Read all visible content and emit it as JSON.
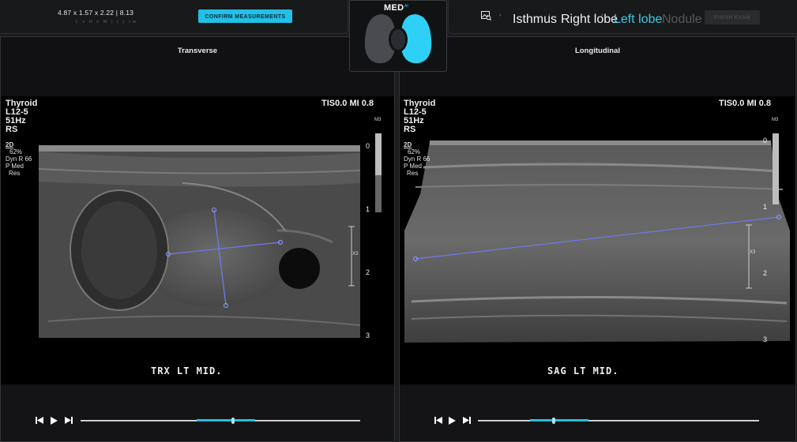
{
  "header": {
    "measurement": "4.87 x 1.57  x  2.22  | 8.13",
    "measurement_sub": "L  x  H  x  W  |  (  )  cm",
    "confirm_label": "CONFIRM MEASUREMENTS",
    "finish_label": "FINISH EXAM",
    "logo": {
      "text": "MED",
      "superscript": "AI"
    },
    "steps": [
      {
        "label": "Isthmus",
        "state": "done"
      },
      {
        "label": "Right lobe",
        "state": "done"
      },
      {
        "label": "Left lobe",
        "state": "active"
      },
      {
        "label": "Nodule",
        "state": "disabled"
      }
    ],
    "colors": {
      "accent": "#22bfe7",
      "active_step": "#3ccbe8",
      "disabled": "#55575b"
    }
  },
  "panels": [
    {
      "title": "Transverse",
      "overlay_left": [
        "Thyroid",
        "L12-5",
        "51Hz",
        "RS"
      ],
      "overlay_right": "TIS0.0  MI 0.8",
      "settings": [
        "2D",
        "62%",
        "Dyn R 66",
        "P Med",
        "Res"
      ],
      "map": "M3",
      "depth_labels": [
        "0",
        "1",
        "2",
        "3"
      ],
      "focus": "X3",
      "caption": "TRX LT  MID.",
      "playback_progress": 0.44
    },
    {
      "title": "Longitudinal",
      "overlay_left": [
        "Thyroid",
        "L12-5",
        "51Hz",
        "RS"
      ],
      "overlay_right": "TIS0.0  MI 0.8",
      "settings": [
        "2D",
        "62%",
        "Dyn R 66",
        "P Med",
        "Res"
      ],
      "map": "M3",
      "depth_labels": [
        "0",
        "1",
        "2",
        "3"
      ],
      "focus": "X3",
      "caption": "SAG LT  MID.",
      "playback_progress": 0.27
    }
  ],
  "icons": {
    "image": "image-search-icon",
    "step_chevron": "chevron-right-icon",
    "skip_back": "skip-back-icon",
    "play": "play-icon",
    "skip_forward": "skip-forward-icon"
  }
}
